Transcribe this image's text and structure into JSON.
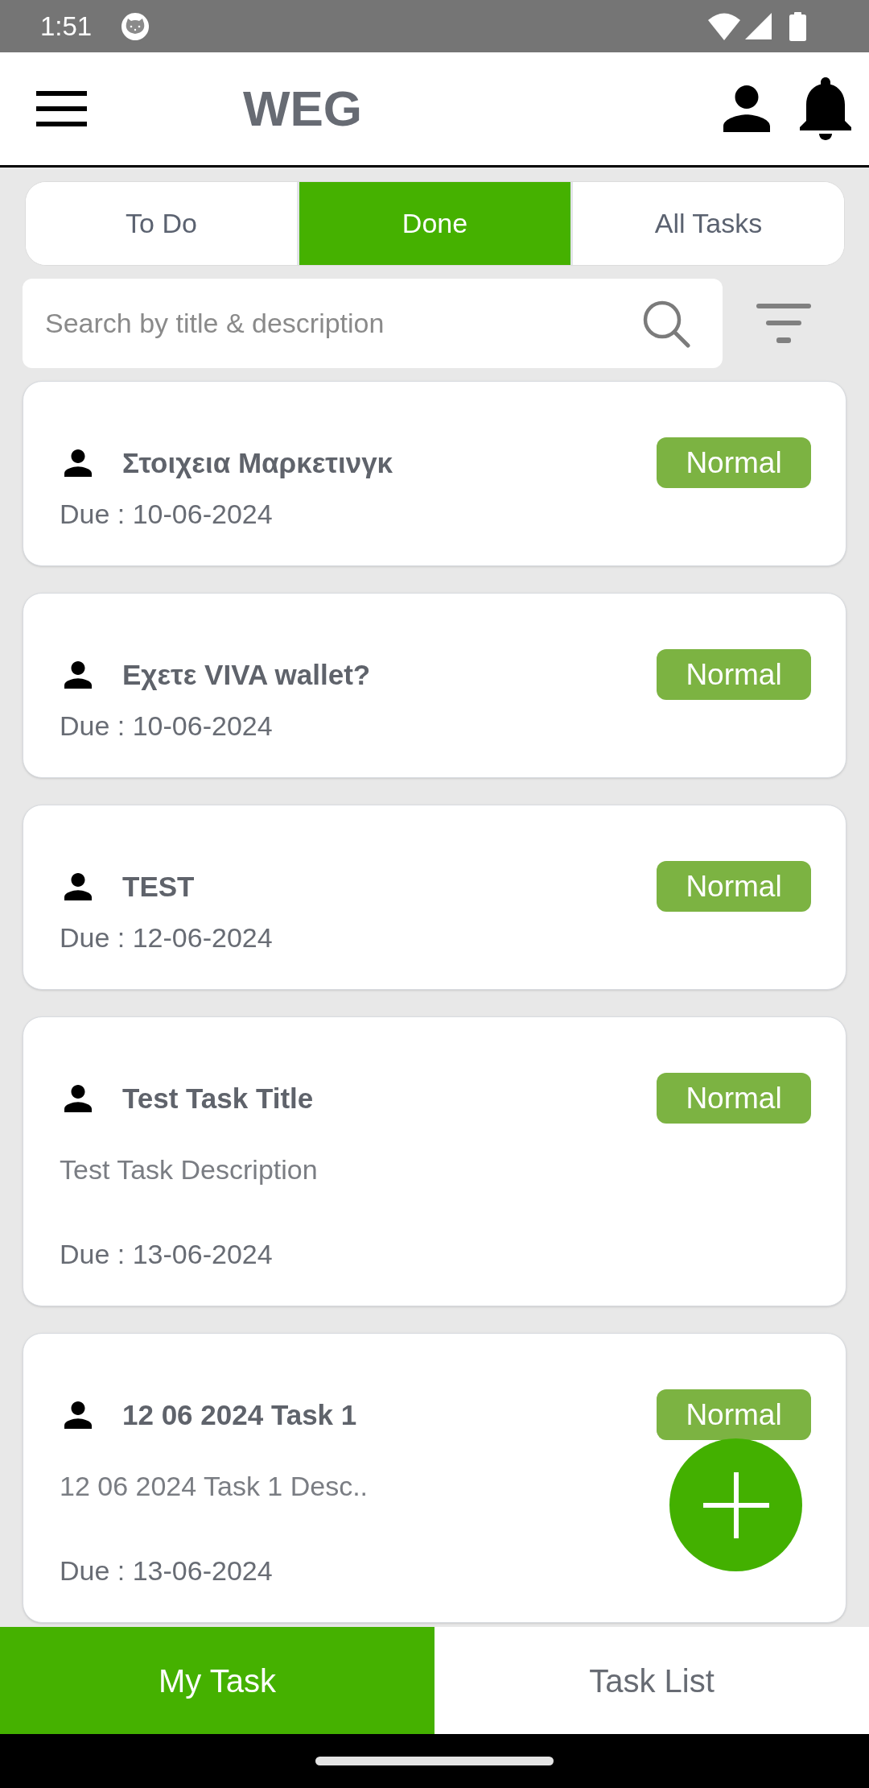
{
  "status_bar": {
    "time": "1:51"
  },
  "app_bar": {
    "title": "WEG"
  },
  "tabs": [
    {
      "label": "To Do",
      "selected": false
    },
    {
      "label": "Done",
      "selected": true
    },
    {
      "label": "All Tasks",
      "selected": false
    }
  ],
  "search": {
    "placeholder": "Search by title & description"
  },
  "tasks": [
    {
      "title": "Στοιχεια Μαρκετινγκ",
      "priority": "Normal",
      "due": "Due : 10-06-2024"
    },
    {
      "title": "Εχετε VIVA wallet?",
      "priority": "Normal",
      "due": "Due : 10-06-2024"
    },
    {
      "title": "TEST",
      "priority": "Normal",
      "due": "Due : 12-06-2024"
    },
    {
      "title": "Test Task Title",
      "description": "Test Task Description",
      "priority": "Normal",
      "due": "Due : 13-06-2024"
    },
    {
      "title": "12 06 2024 Task 1",
      "description": "12 06 2024 Task 1 Desc..",
      "priority": "Normal",
      "due": "Due : 13-06-2024"
    }
  ],
  "bottom_nav": [
    {
      "label": "My Task",
      "selected": true
    },
    {
      "label": "Task List",
      "selected": false
    }
  ]
}
